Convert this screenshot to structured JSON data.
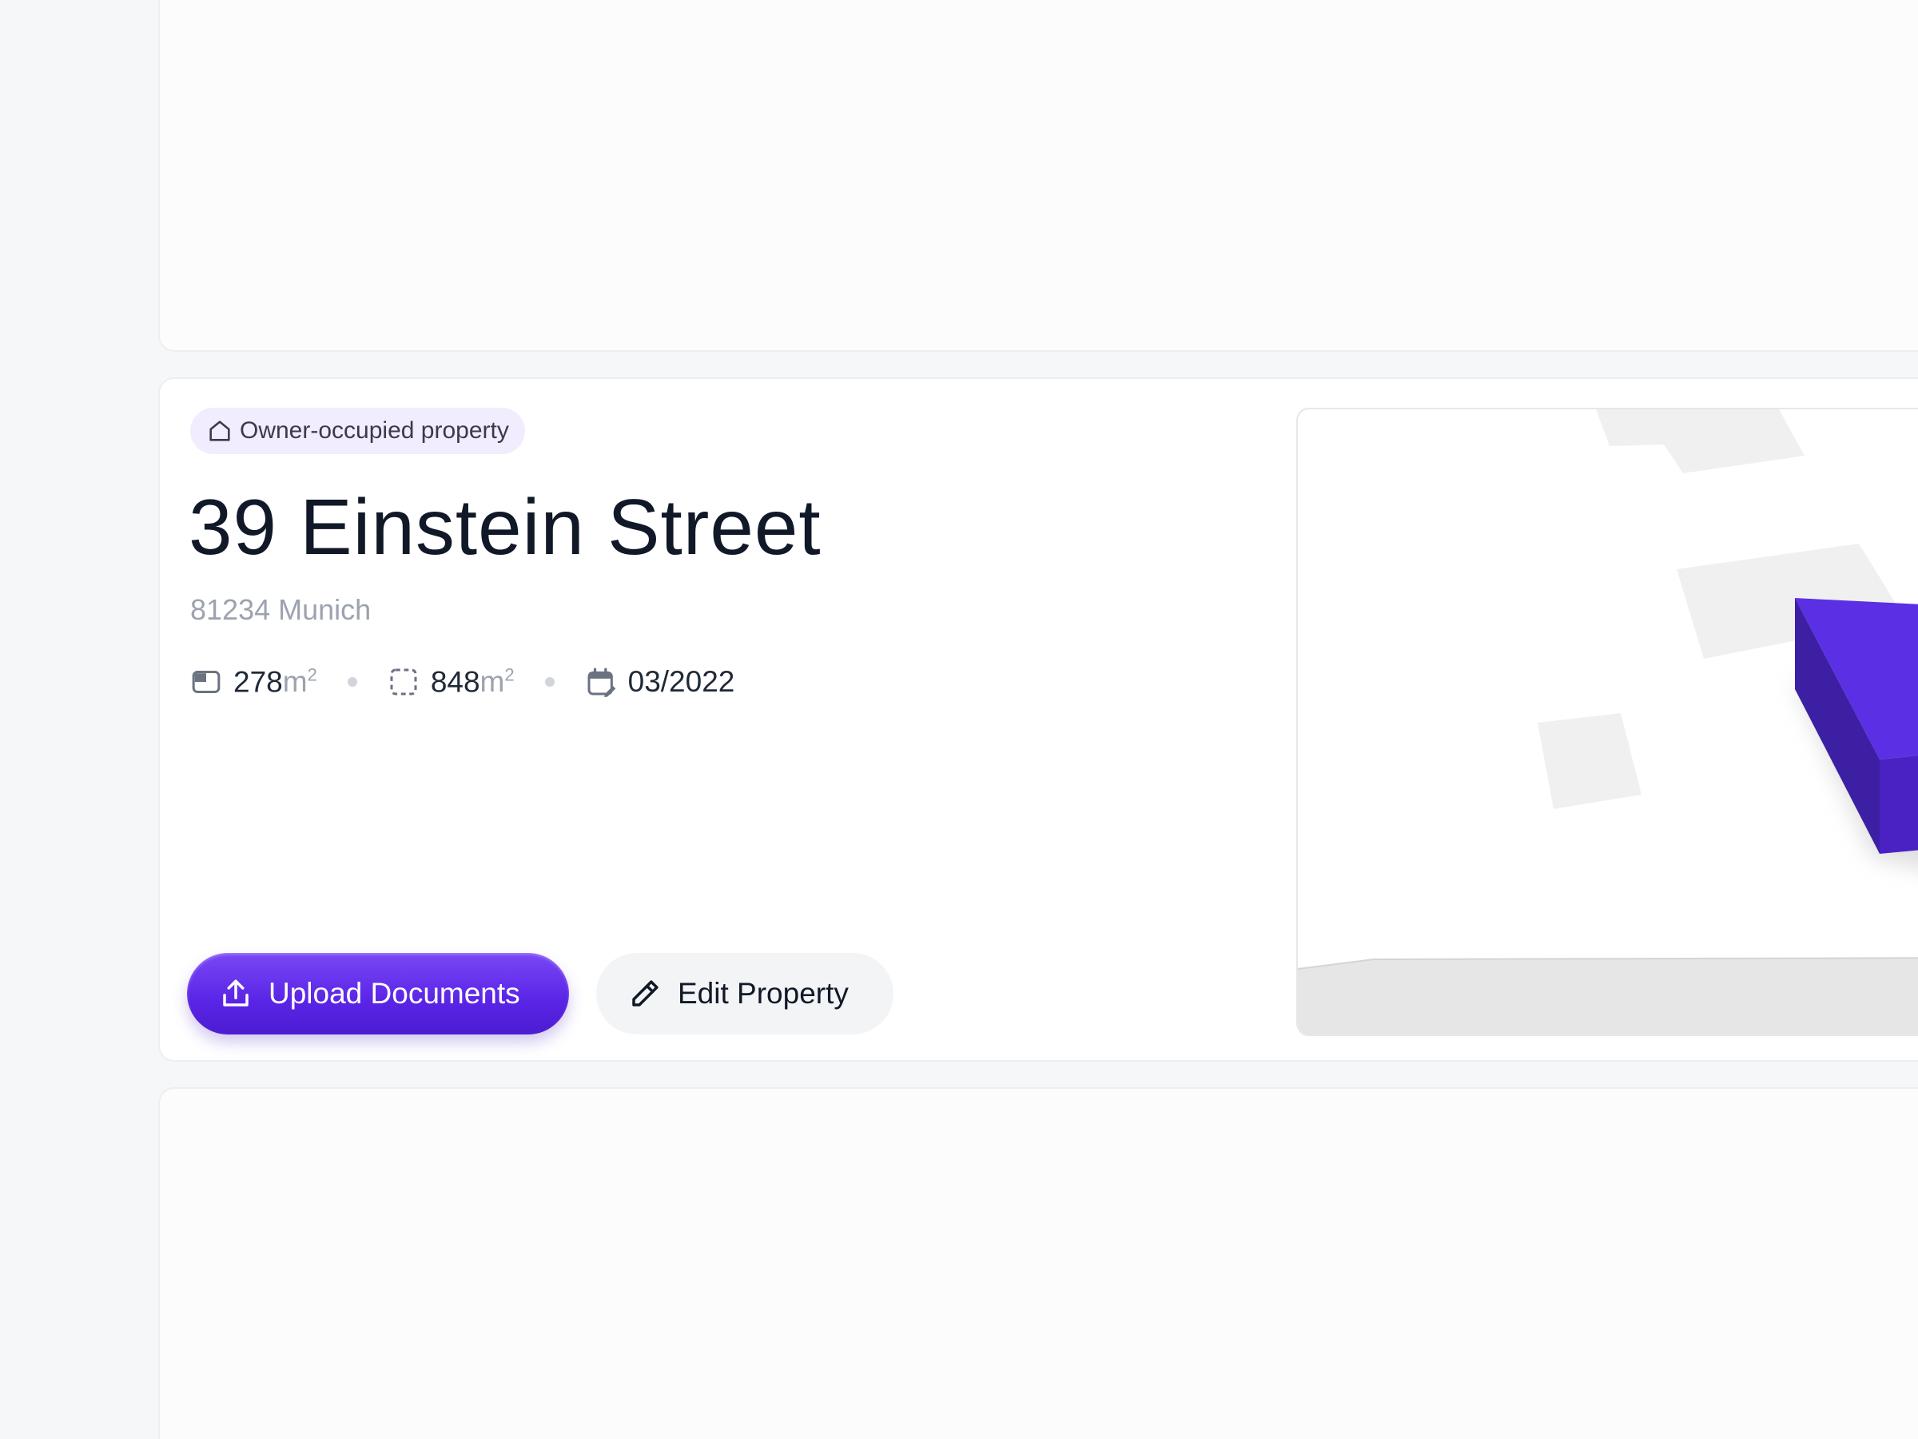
{
  "property": {
    "badge_label": "Owner-occupied property",
    "badge_icon": "home-icon",
    "title": "39 Einstein Street",
    "location": "81234 Munich",
    "stats": {
      "living_area_value": "278",
      "living_area_unit": "m",
      "plot_area_value": "848",
      "plot_area_unit": "m",
      "unit_superscript": "2",
      "date": "03/2022"
    }
  },
  "actions": {
    "upload_label": "Upload Documents",
    "edit_label": "Edit Property"
  },
  "colors": {
    "accent": "#5a24e6",
    "badge_bg": "#f1ecfe",
    "title": "#111827",
    "muted": "#9ca3af"
  }
}
